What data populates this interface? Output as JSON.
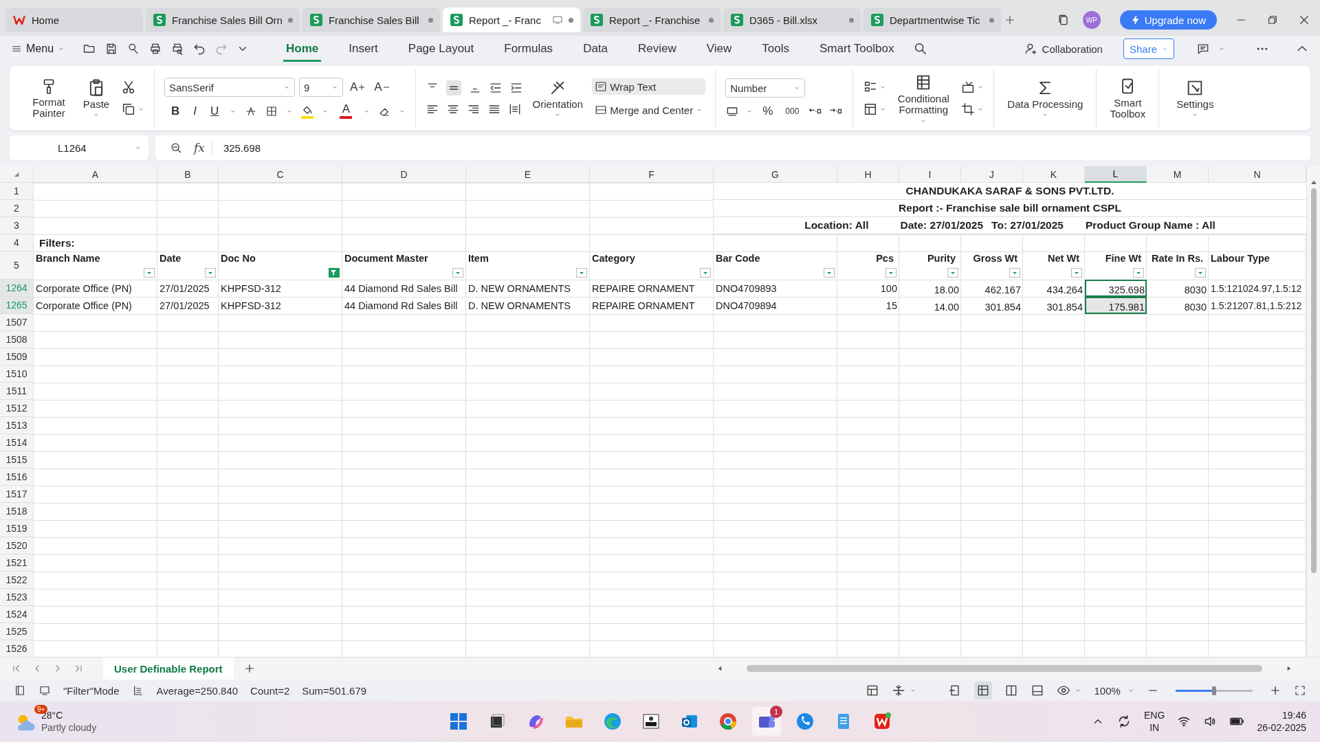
{
  "tabs": [
    {
      "label": "Home",
      "selected": false,
      "kind": "home"
    },
    {
      "label": "Franchise Sales Bill Orn",
      "selected": false,
      "kind": "sheet"
    },
    {
      "label": "Franchise Sales Bill",
      "selected": false,
      "kind": "sheet"
    },
    {
      "label": "Report _- Franc",
      "selected": true,
      "kind": "sheet"
    },
    {
      "label": "Report _- Franchise",
      "selected": false,
      "kind": "sheet"
    },
    {
      "label": "D365 - Bill.xlsx",
      "selected": false,
      "kind": "sheet"
    },
    {
      "label": "Departmentwise Tic",
      "selected": false,
      "kind": "sheet"
    }
  ],
  "account": {
    "initials": "WP"
  },
  "upgrade": "Upgrade now",
  "menu": "Menu",
  "ribbon_tabs": [
    {
      "label": "Home",
      "selected": true
    },
    {
      "label": "Insert",
      "selected": false
    },
    {
      "label": "Page Layout",
      "selected": false
    },
    {
      "label": "Formulas",
      "selected": false
    },
    {
      "label": "Data",
      "selected": false
    },
    {
      "label": "Review",
      "selected": false
    },
    {
      "label": "View",
      "selected": false
    },
    {
      "label": "Tools",
      "selected": false
    },
    {
      "label": "Smart Toolbox",
      "selected": false
    }
  ],
  "collaboration": "Collaboration",
  "share": "Share",
  "ribbon": {
    "format_painter": "Format Painter",
    "paste": "Paste",
    "font": "SansSerif",
    "font_size": "9",
    "grow_font": "A",
    "shrink_font": "A",
    "style_buttons": [
      "B",
      "I",
      "U"
    ],
    "font_color": "A",
    "wrap_text": "Wrap Text",
    "orientation": "Orientation",
    "merge": "Merge and Center",
    "number_format": "Number",
    "percent": "%",
    "thousands": "000",
    "conditional": "Conditional Formatting",
    "data_processing": "Data Processing",
    "smart_toolbox": "Smart Toolbox",
    "settings": "Settings"
  },
  "formula_bar": {
    "cell": "L1264",
    "fx": "fx",
    "value": "325.698"
  },
  "sheet": {
    "columns": [
      {
        "label": "A",
        "selected": false
      },
      {
        "label": "B",
        "selected": false
      },
      {
        "label": "C",
        "selected": false
      },
      {
        "label": "D",
        "selected": false
      },
      {
        "label": "E",
        "selected": false
      },
      {
        "label": "F",
        "selected": false
      },
      {
        "label": "G",
        "selected": false
      },
      {
        "label": "H",
        "selected": false
      },
      {
        "label": "I",
        "selected": false
      },
      {
        "label": "J",
        "selected": false
      },
      {
        "label": "K",
        "selected": false
      },
      {
        "label": "L",
        "selected": true
      },
      {
        "label": "M",
        "selected": false
      },
      {
        "label": "N",
        "selected": false
      }
    ],
    "title_rows": [
      {
        "row": "1",
        "texts": [
          "CHANDUKAKA SARAF & SONS PVT.LTD."
        ]
      },
      {
        "row": "2",
        "texts": [
          "Report :- Franchise sale bill ornament CSPL"
        ]
      },
      {
        "row": "3",
        "texts": [
          "Location: All",
          "Date: 27/01/2025",
          "To: 27/01/2025",
          "Product Group Name : All"
        ]
      }
    ],
    "filters_row": {
      "row": "4",
      "label": "Filters:"
    },
    "header_row": {
      "row": "5",
      "cells": [
        {
          "text": "Branch Name",
          "kind": "dropdown"
        },
        {
          "text": "Date",
          "kind": "dropdown"
        },
        {
          "text": "Doc No",
          "kind": "filtered"
        },
        {
          "text": "Document Master",
          "kind": "dropdown"
        },
        {
          "text": "Item",
          "kind": "dropdown"
        },
        {
          "text": "Category",
          "kind": "dropdown"
        },
        {
          "text": "Bar Code",
          "kind": "dropdown"
        },
        {
          "text": "Pcs",
          "kind": "dropdown"
        },
        {
          "text": "Purity",
          "kind": "dropdown"
        },
        {
          "text": "Gross Wt",
          "kind": "dropdown"
        },
        {
          "text": "Net Wt",
          "kind": "dropdown"
        },
        {
          "text": "Fine Wt",
          "kind": "dropdown"
        },
        {
          "text": "Rate In Rs.",
          "kind": "dropdown"
        },
        {
          "text": "Labour Type",
          "kind": "plain"
        }
      ]
    },
    "data_rows": [
      {
        "row": "1264",
        "selected": true,
        "cells": [
          "Corporate Office (PN)",
          "27/01/2025",
          "KHPFSD-312",
          "44 Diamond Rd Sales Bill",
          "D. NEW ORNAMENTS",
          "REPAIRE ORNAMENT",
          "DNO4709893",
          "100",
          "18.00",
          "462.167",
          "434.264",
          "325.698",
          "8030",
          "1.5:121024.97,1.5:12"
        ]
      },
      {
        "row": "1265",
        "selected": true,
        "cells": [
          "Corporate Office (PN)",
          "27/01/2025",
          "KHPFSD-312",
          "44 Diamond Rd Sales Bill",
          "D. NEW ORNAMENTS",
          "REPAIRE ORNAMENT",
          "DNO4709894",
          "15",
          "14.00",
          "301.854",
          "301.854",
          "175.981",
          "8030",
          "1.5:21207.81,1.5:212"
        ]
      }
    ],
    "empty_rows": [
      "1507",
      "1508",
      "1509",
      "1510",
      "1511",
      "1512",
      "1513",
      "1514",
      "1515",
      "1516",
      "1517",
      "1518",
      "1519",
      "1520",
      "1521",
      "1522",
      "1523",
      "1524",
      "1525",
      "1526"
    ]
  },
  "sheet_tabs": [
    {
      "label": "User Definable Report",
      "selected": true
    }
  ],
  "status_bar": {
    "mode": "\"Filter\"Mode",
    "average": "Average=250.840",
    "count": "Count=2",
    "sum": "Sum=501.679",
    "zoom": "100%",
    "zoom_slider": {
      "level": 0.5
    }
  },
  "taskbar": {
    "weather": {
      "badge": "9+",
      "temp": "28°C",
      "text": "Partly cloudy"
    },
    "teams_badge": "1",
    "language": [
      "ENG",
      "IN"
    ],
    "time": "19:46",
    "date": "26-02-2025"
  }
}
